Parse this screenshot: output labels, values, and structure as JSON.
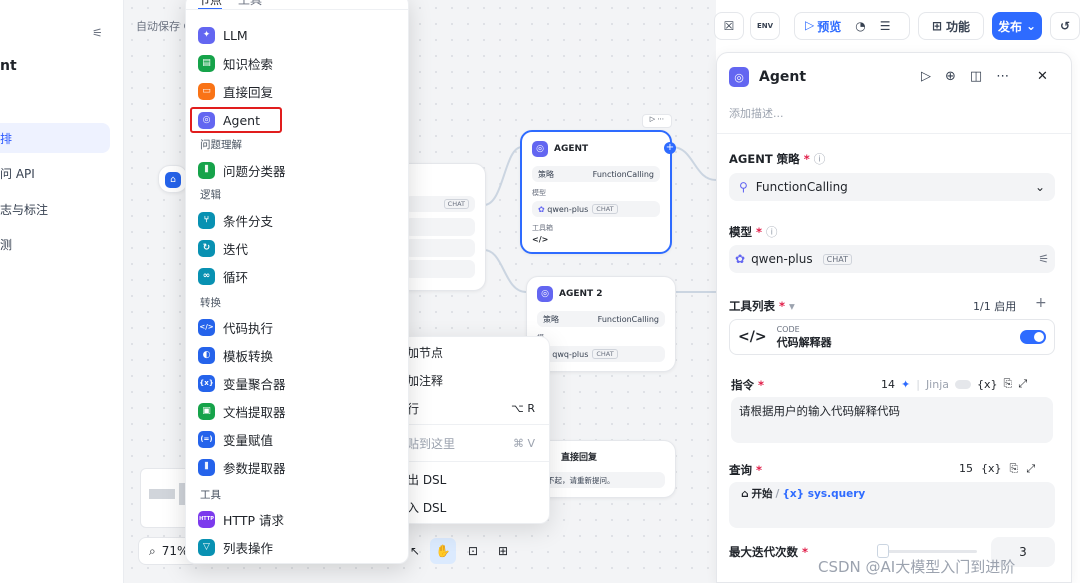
{
  "sidebar": {
    "top_title": "nt",
    "items": [
      {
        "label": "排"
      },
      {
        "label": "问 API"
      },
      {
        "label": "志与标注"
      },
      {
        "label": "测"
      }
    ]
  },
  "autosave": "自动保存 C",
  "menu": {
    "tabs": [
      "节点",
      "工具"
    ],
    "items": [
      {
        "label": "LLM",
        "color": "#6366f1",
        "glyph": "✦"
      },
      {
        "label": "知识检索",
        "color": "#16a34a",
        "glyph": "▤"
      },
      {
        "label": "直接回复",
        "color": "#f97316",
        "glyph": "▭"
      },
      {
        "label": "Agent",
        "color": "#6366f1",
        "glyph": "◎"
      }
    ],
    "section_question": "问题理解",
    "item_classifier": "问题分类器",
    "section_logic": "逻辑",
    "logic_items": [
      {
        "label": "条件分支",
        "color": "#0891b2",
        "glyph": "⑂"
      },
      {
        "label": "迭代",
        "color": "#0891b2",
        "glyph": "↻"
      },
      {
        "label": "循环",
        "color": "#0891b2",
        "glyph": "∞"
      }
    ],
    "section_transform": "转换",
    "transform_items": [
      {
        "label": "代码执行",
        "color": "#2563eb",
        "glyph": "</>"
      },
      {
        "label": "模板转换",
        "color": "#2563eb",
        "glyph": "◐"
      },
      {
        "label": "变量聚合器",
        "color": "#2563eb",
        "glyph": "{x}"
      },
      {
        "label": "文档提取器",
        "color": "#16a34a",
        "glyph": "▣"
      },
      {
        "label": "变量赋值",
        "color": "#2563eb",
        "glyph": "(=)"
      },
      {
        "label": "参数提取器",
        "color": "#2563eb",
        "glyph": "⦀"
      }
    ],
    "section_tools": "工具",
    "tool_items": [
      {
        "label": "HTTP 请求",
        "color": "#7c3aed",
        "glyph": "HTTP"
      },
      {
        "label": "列表操作",
        "color": "#0891b2",
        "glyph": "▽"
      }
    ]
  },
  "nodes": {
    "agent1": {
      "title": "AGENT",
      "strategy_label": "策略",
      "strategy": "FunctionCalling",
      "model_label": "模型",
      "model": "qwen-plus",
      "model_tag": "CHAT",
      "tools_label": "工具箱",
      "tool_glyph": "</>"
    },
    "agent2": {
      "title": "AGENT 2",
      "strategy_label": "策略",
      "strategy": "FunctionCalling",
      "model_label": "模",
      "model": "qwq-plus",
      "model_tag": "CHAT"
    },
    "reply": {
      "title": "直接回复",
      "text": "不起，请重新提问。"
    },
    "partial_tag": "CHAT"
  },
  "context_menu": [
    {
      "label": "加节点",
      "shortcut": ""
    },
    {
      "label": "加注释",
      "shortcut": ""
    },
    {
      "label": "行",
      "shortcut": "⌥ R"
    },
    {
      "label": "贴到这里",
      "shortcut": "⌘ V"
    },
    {
      "label": "出 DSL",
      "shortcut": ""
    },
    {
      "label": "入 DSL",
      "shortcut": ""
    }
  ],
  "zoom": "71%",
  "toolbar": {
    "preview": "预览",
    "features": "功能",
    "publish": "发布",
    "env": "ENV"
  },
  "panel": {
    "title": "Agent",
    "description_placeholder": "添加描述...",
    "strategy_label": "AGENT 策略",
    "strategy_value": "FunctionCalling",
    "model_label": "模型",
    "model_value": "qwen-plus",
    "model_tag": "CHAT",
    "tools_label": "工具列表",
    "tools_enabled": "1/1 启用",
    "tool_category": "CODE",
    "tool_name": "代码解释器",
    "tool_enabled": true,
    "instruction_label": "指令",
    "instruction_count": "14",
    "jinja_label": "Jinja",
    "var_label": "{x}",
    "instruction_text": "请根据用户的输入代码解释代码",
    "query_label": "查询",
    "query_count": "15",
    "query_source": "开始",
    "query_var": "{x} sys.query",
    "max_iter_label": "最大迭代次数",
    "max_iter_value": "3"
  },
  "watermark": "CSDN @AI大模型入门到进阶",
  "colors": {
    "accent": "#2e6bff",
    "highlight": "#e11d1d"
  }
}
